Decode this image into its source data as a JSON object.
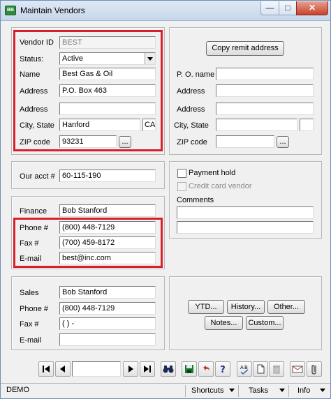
{
  "window": {
    "title": "Maintain Vendors",
    "app_icon": "app-logo",
    "close_icon": "close-icon",
    "minimize_icon": "minimize-icon",
    "maximize_icon": "maximize-icon"
  },
  "vendor": {
    "vendor_id_label": "Vendor ID",
    "vendor_id": "BEST",
    "status_label": "Status:",
    "status": "Active",
    "name_label": "Name",
    "name": "Best Gas & Oil",
    "address_label": "Address",
    "address1": "P.O. Box 463",
    "address2_label": "Address",
    "address2": "",
    "city_state_label": "City, State",
    "city": "Hanford",
    "state": "CA",
    "zip_label": "ZIP code",
    "zip": "93231",
    "zip_lookup": "..."
  },
  "remit": {
    "copy_button": "Copy remit address",
    "po_name_label": "P. O. name",
    "po_name": "",
    "address_label": "Address",
    "address1": "",
    "address2_label": "Address",
    "address2": "",
    "city_state_label": "City, State",
    "city": "",
    "state": "",
    "zip_label": "ZIP code",
    "zip": "",
    "zip_lookup": "..."
  },
  "account": {
    "our_acct_label": "Our acct #",
    "our_acct": "60-115-190"
  },
  "options": {
    "payment_hold_label": "Payment hold",
    "credit_card_label": "Credit card vendor",
    "comments_label": "Comments",
    "comment1": "",
    "comment2": ""
  },
  "finance": {
    "finance_label": "Finance",
    "finance": "Bob Stanford",
    "phone_label": "Phone #",
    "phone": "(800) 448-7129",
    "fax_label": "Fax #",
    "fax": "(700) 459-8172",
    "email_label": "E-mail",
    "email": "best@inc.com"
  },
  "sales": {
    "sales_label": "Sales",
    "sales": "Bob Stanford",
    "phone_label": "Phone #",
    "phone": "(800) 448-7129",
    "fax_label": "Fax #",
    "fax": "(   )    -",
    "email_label": "E-mail",
    "email": ""
  },
  "actions": {
    "ytd": "YTD...",
    "history": "History...",
    "other": "Other...",
    "notes": "Notes...",
    "custom": "Custom..."
  },
  "toolbar": {
    "record": ""
  },
  "status_bar": {
    "company": "DEMO",
    "shortcuts": "Shortcuts",
    "tasks": "Tasks",
    "info": "Info"
  },
  "colors": {
    "highlight": "#d8202a",
    "panel_bg": "#f0f0f0"
  }
}
